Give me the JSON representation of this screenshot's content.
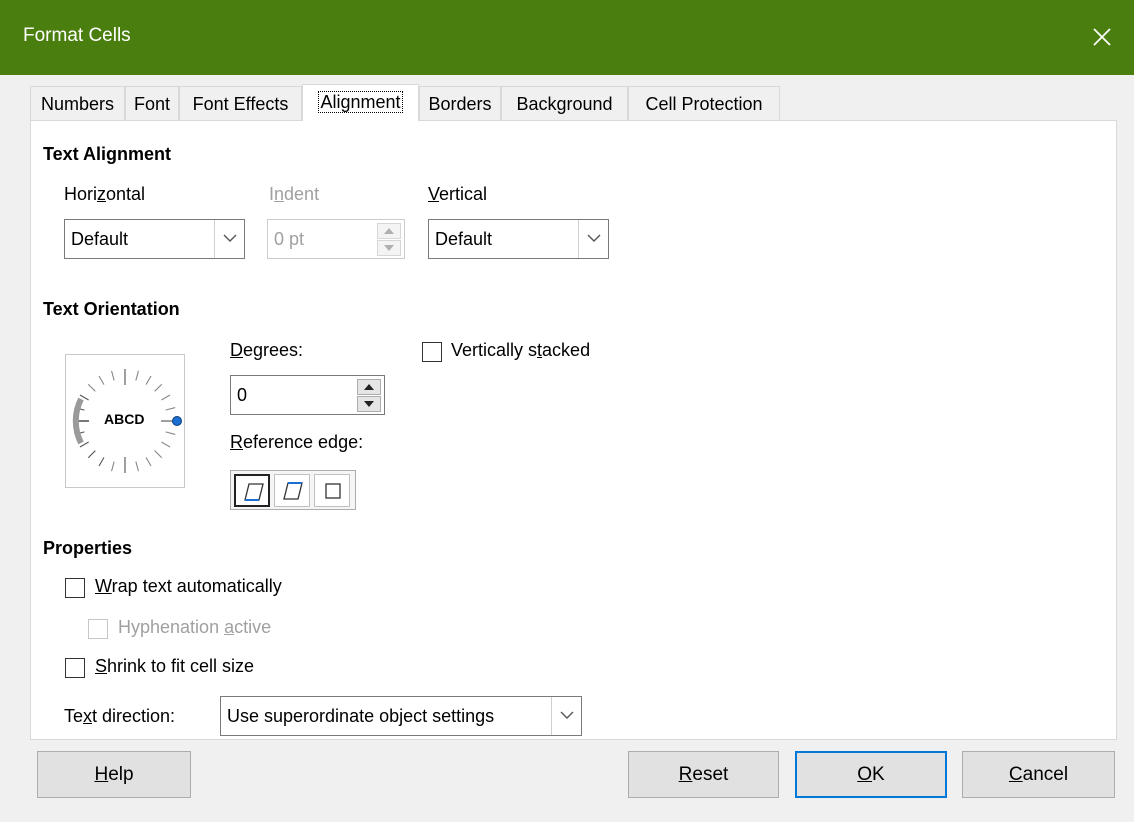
{
  "window": {
    "title": "Format Cells"
  },
  "tabs": [
    {
      "label": "Numbers"
    },
    {
      "label": "Font"
    },
    {
      "label": "Font Effects"
    },
    {
      "label": "Alignment",
      "active": true
    },
    {
      "label": "Borders"
    },
    {
      "label": "Background"
    },
    {
      "label": "Cell Protection"
    }
  ],
  "text_alignment": {
    "heading": "Text Alignment",
    "horizontal": {
      "label_pre": "Hori",
      "label_key": "z",
      "label_post": "ontal",
      "value": "Default"
    },
    "indent": {
      "label_pre": "I",
      "label_key": "n",
      "label_post": "dent",
      "value": "0 pt"
    },
    "vertical": {
      "label_pre": "",
      "label_key": "V",
      "label_post": "ertical",
      "value": "Default"
    }
  },
  "text_orientation": {
    "heading": "Text Orientation",
    "dial_text": "ABCD",
    "degrees": {
      "label_pre": "",
      "label_key": "D",
      "label_post": "egrees:",
      "value": "0"
    },
    "reference_edge": {
      "label_pre": "",
      "label_key": "R",
      "label_post": "eference edge:"
    },
    "vertically_stacked": {
      "label_pre": "Vertically s",
      "label_key": "t",
      "label_post": "acked",
      "checked": false
    }
  },
  "properties": {
    "heading": "Properties",
    "wrap": {
      "label_pre": "",
      "label_key": "W",
      "label_post": "rap text automatically",
      "checked": false
    },
    "hyphenation": {
      "label_pre": "Hyphenation ",
      "label_key": "a",
      "label_post": "ctive",
      "checked": false
    },
    "shrink": {
      "label_pre": "",
      "label_key": "S",
      "label_post": "hrink to fit cell size",
      "checked": false
    },
    "text_direction": {
      "label_pre": "Te",
      "label_key": "x",
      "label_post": "t direction:",
      "value": "Use superordinate object settings"
    }
  },
  "buttons": {
    "help": {
      "key": "H",
      "rest": "elp"
    },
    "reset": {
      "key": "R",
      "rest": "eset"
    },
    "ok": {
      "key": "O",
      "rest": "K"
    },
    "cancel": {
      "key": "C",
      "rest": "ancel"
    }
  },
  "colors": {
    "titlebar": "#4a7e0f",
    "dial_indicator": "#1a6fd1",
    "default_button_border": "#0078d7"
  }
}
